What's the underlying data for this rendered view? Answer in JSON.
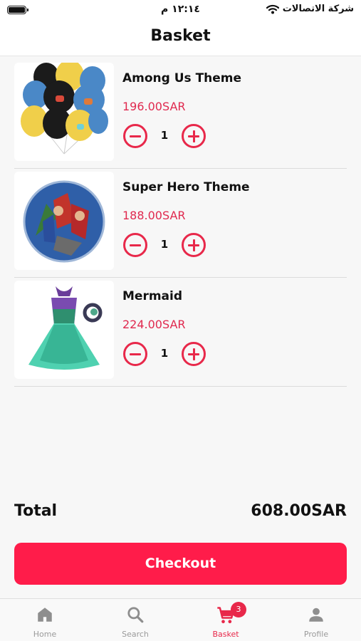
{
  "status_bar": {
    "time": "١٢:١٤ م",
    "carrier": "شركة الاتصالات"
  },
  "header": {
    "title": "Basket"
  },
  "items": [
    {
      "name": "Among Us Theme",
      "price": "196.00SAR",
      "quantity": "1",
      "image_icon": "balloons-image"
    },
    {
      "name": "Super Hero Theme",
      "price": "188.00SAR",
      "quantity": "1",
      "image_icon": "superhero-plate-image"
    },
    {
      "name": "Mermaid",
      "price": "224.00SAR",
      "quantity": "1",
      "image_icon": "mermaid-dress-image"
    }
  ],
  "summary": {
    "total_label": "Total",
    "total_value": "608.00SAR"
  },
  "checkout": {
    "label": "Checkout"
  },
  "tab_bar": {
    "tabs": [
      {
        "label": "Home",
        "icon": "home-icon",
        "active": false
      },
      {
        "label": "Search",
        "icon": "search-icon",
        "active": false
      },
      {
        "label": "Basket",
        "icon": "cart-icon",
        "active": true,
        "badge": "3"
      },
      {
        "label": "Profile",
        "icon": "person-icon",
        "active": false
      }
    ]
  },
  "colors": {
    "accent": "#ff1c4a",
    "price": "#e0294f",
    "inactive_tab": "#9a9a9a",
    "background": "#f7f7f7"
  }
}
